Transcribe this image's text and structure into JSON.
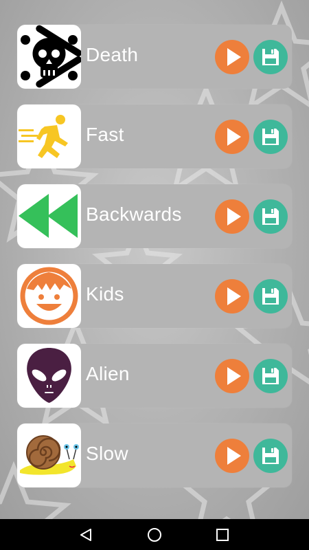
{
  "effects": [
    {
      "name": "Death",
      "icon": "skull-crossbones-icon"
    },
    {
      "name": "Fast",
      "icon": "running-man-icon"
    },
    {
      "name": "Backwards",
      "icon": "rewind-icon"
    },
    {
      "name": "Kids",
      "icon": "kid-face-icon"
    },
    {
      "name": "Alien",
      "icon": "alien-face-icon"
    },
    {
      "name": "Slow",
      "icon": "snail-icon"
    }
  ],
  "colors": {
    "play": "#ee7f3b",
    "save": "#3fb89a",
    "row_bg": "#b4b4b4",
    "navbar": "#000000"
  },
  "navbar": {
    "back": "back-triangle-icon",
    "home": "home-circle-icon",
    "recents": "recents-square-icon"
  }
}
